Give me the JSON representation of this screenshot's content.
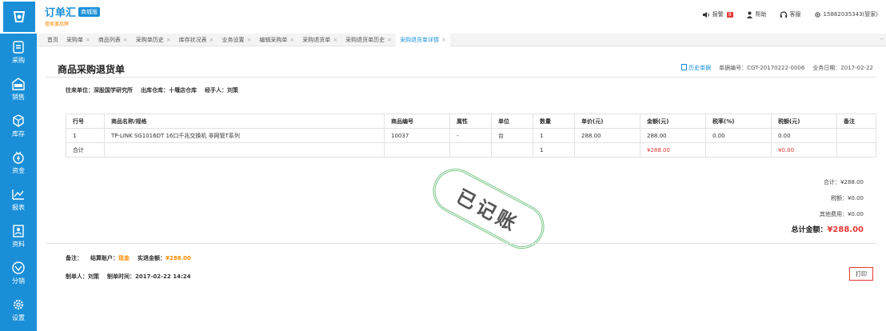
{
  "app": {
    "title": "订单汇",
    "badge": "商城版",
    "subtitle": "管家婆品牌"
  },
  "topbar": {
    "alarm_label": "报警",
    "alarm_count": "9",
    "help_label": "帮助",
    "service_label": "客服",
    "user_label": "15882035343(管家)"
  },
  "sidebar": {
    "items": [
      {
        "label": "采购",
        "icon": "purchase-icon"
      },
      {
        "label": "销售",
        "icon": "sale-icon"
      },
      {
        "label": "库存",
        "icon": "inventory-icon"
      },
      {
        "label": "资金",
        "icon": "funds-icon"
      },
      {
        "label": "报表",
        "icon": "report-icon"
      },
      {
        "label": "资料",
        "icon": "data-icon"
      },
      {
        "label": "分销",
        "icon": "distribution-icon"
      },
      {
        "label": "设置",
        "icon": "settings-icon"
      }
    ]
  },
  "tabs": [
    {
      "label": "首页"
    },
    {
      "label": "采购单"
    },
    {
      "label": "商品列表"
    },
    {
      "label": "采购单历史"
    },
    {
      "label": "库存状况表"
    },
    {
      "label": "业务设置"
    },
    {
      "label": "编辑采购单"
    },
    {
      "label": "采购退货单"
    },
    {
      "label": "采购退货单历史"
    },
    {
      "label": "采购退货单详情"
    }
  ],
  "page": {
    "title": "商品采购退货单",
    "history_link": "历史单据",
    "doc_no": "单据编号：CGT-20170222-0006",
    "biz_date": "业务日期：2017-02-22",
    "counterparty": "往来单位：深股国学研究所",
    "warehouse": "出库仓库：十堰店仓库",
    "handler": "经手人：刘策"
  },
  "table": {
    "headers": [
      "行号",
      "商品名称/规格",
      "商品编号",
      "属性",
      "单位",
      "数量",
      "单价(元)",
      "金额(元)",
      "税率(%)",
      "税额(元)",
      "备注"
    ],
    "rows": [
      [
        "1",
        "TP-LINK SG1016DT 16口千兆交换机 非网管T系列",
        "10037",
        "-",
        "台",
        "1",
        "288.00",
        "288.00",
        "0.00",
        "0.00",
        ""
      ]
    ],
    "total_row": {
      "label": "合计",
      "qty": "1",
      "amount": "¥288.00",
      "tax": "¥0.00"
    }
  },
  "stamp": "已记账",
  "summary": {
    "subtotal": "合计：¥288.00",
    "tax": "税额：¥0.00",
    "other": "其他费用：¥0.00",
    "total_label": "总计金额：",
    "total_value": "¥288.00"
  },
  "footer": {
    "note_label": "备注：",
    "account": "结算账户：",
    "account_value": "现金",
    "paid": "实退金额：",
    "paid_value": "¥288.00",
    "maker": "制单人：刘策",
    "make_time": "制单时间：2017-02-22 14:24",
    "print_label": "打印"
  },
  "colors": {
    "primary": "#1a8fd8",
    "accent_red": "#e53935",
    "accent_orange": "#ff8a00",
    "stamp_green": "#7bc68a"
  }
}
